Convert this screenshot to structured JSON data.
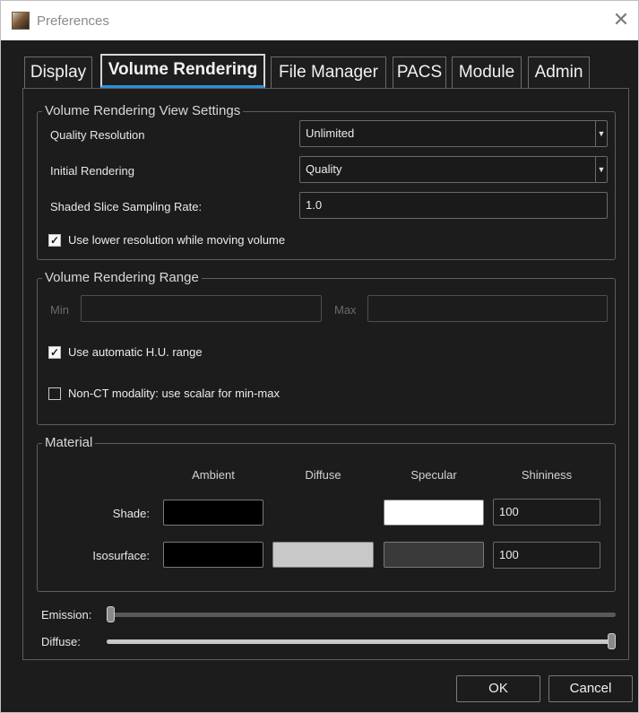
{
  "window": {
    "title": "Preferences",
    "close_glyph": "✕"
  },
  "tabs": [
    {
      "label": "Display",
      "active": false
    },
    {
      "label": "Volume Rendering",
      "active": true
    },
    {
      "label": "File Manager",
      "active": false
    },
    {
      "label": "PACS",
      "active": false
    },
    {
      "label": "Module",
      "active": false
    },
    {
      "label": "Admin",
      "active": false
    }
  ],
  "view_settings": {
    "title": "Volume Rendering View Settings",
    "quality_resolution": {
      "label": "Quality Resolution",
      "value": "Unlimited"
    },
    "initial_rendering": {
      "label": "Initial Rendering",
      "value": "Quality"
    },
    "sampling_rate": {
      "label": "Shaded Slice Sampling Rate:",
      "value": "1.0"
    },
    "lower_resolution": {
      "label": "Use lower resolution while moving volume",
      "checked": true
    }
  },
  "range": {
    "title": "Volume Rendering Range",
    "min_label": "Min",
    "min_value": "",
    "max_label": "Max",
    "max_value": "",
    "auto_hu": {
      "label": "Use automatic H.U. range",
      "checked": true
    },
    "non_ct": {
      "label": "Non-CT modality: use scalar for min-max",
      "checked": false
    }
  },
  "material": {
    "title": "Material",
    "columns": [
      "Ambient",
      "Diffuse",
      "Specular",
      "Shininess"
    ],
    "shade": {
      "label": "Shade:",
      "ambient_color": "#000000",
      "specular_color": "#ffffff",
      "shininess": "100"
    },
    "isosurface": {
      "label": "Isosurface:",
      "ambient_color": "#000000",
      "diffuse_color": "#c8c8c8",
      "specular_color": "#3a3a3a",
      "shininess": "100"
    }
  },
  "sliders": {
    "emission": {
      "label": "Emission:",
      "value": 0.0
    },
    "diffuse": {
      "label": "Diffuse:",
      "value": 1.0
    }
  },
  "buttons": {
    "ok": "OK",
    "cancel": "Cancel"
  },
  "check_glyph": "✓"
}
